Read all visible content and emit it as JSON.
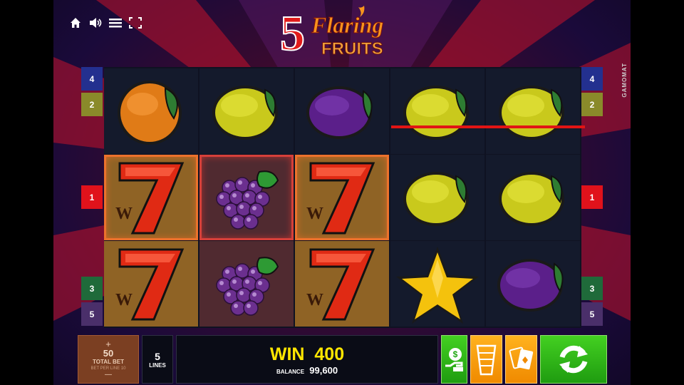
{
  "game": {
    "logo_number": "5",
    "logo_word1": "Flaring",
    "logo_word2": "FRUITS",
    "provider": "GAMOMAT"
  },
  "topbar_icons": [
    "home-icon",
    "speaker-icon",
    "menu-icon",
    "fullscreen-icon"
  ],
  "reels": [
    [
      "orange",
      "seven",
      "seven"
    ],
    [
      "lemon",
      "grapes",
      "grapes"
    ],
    [
      "plum",
      "seven",
      "seven"
    ],
    [
      "lemon",
      "lemon",
      "star"
    ],
    [
      "lemon",
      "lemon",
      "plum"
    ]
  ],
  "winning_cells": [
    [
      0,
      1
    ],
    [
      1,
      1
    ],
    [
      2,
      1
    ]
  ],
  "wild_letter": "W",
  "line_markers": {
    "left": [
      "4",
      "2",
      "1",
      "3",
      "5"
    ],
    "right": [
      "4",
      "2",
      "1",
      "3",
      "5"
    ]
  },
  "marker_colors": {
    "1": "#e0121b",
    "2": "#8a8a2a",
    "3": "#1f6a3a",
    "4": "#23308f",
    "5": "#4a2f6a"
  },
  "panel": {
    "bet_plus": "+",
    "bet_value": "50",
    "bet_label": "TOTAL BET",
    "bet_sublabel": "BET PER LINE 10",
    "bet_minus": "—",
    "lines_value": "5",
    "lines_label": "LINES",
    "win_label": "WIN",
    "win_value": "400",
    "balance_label": "BALANCE",
    "balance_value": "99,600"
  },
  "buttons": [
    "money-icon",
    "gamble-ladder-icon",
    "cards-icon",
    "autoplay-spin-icon"
  ],
  "colors": {
    "accent_win": "#ffe600",
    "spin_green": "#2bb514",
    "orange_btn": "#f39a0c"
  }
}
